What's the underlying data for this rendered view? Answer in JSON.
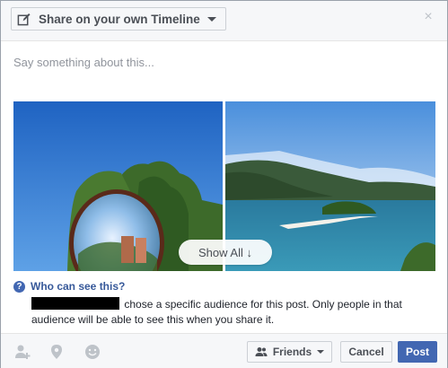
{
  "header": {
    "share_dropdown_label": "Share on your own Timeline",
    "close_symbol": "×",
    "icons": {
      "edit": "pencil-square-icon",
      "dropdown": "caret-down-icon",
      "close": "close-icon"
    }
  },
  "composer": {
    "placeholder": "Say something about this..."
  },
  "attachments": {
    "show_all_label": "Show All ↓"
  },
  "privacy": {
    "question": "Who can see this?",
    "description": "chose a specific audience for this post. Only people in that audience will be able to see this when you share it.",
    "icons": {
      "help": "question-circle-icon"
    },
    "question_mark": "?"
  },
  "footer": {
    "icons": [
      "tag-friends-icon",
      "check-in-icon",
      "feeling-icon"
    ],
    "audience_label": "Friends",
    "cancel_label": "Cancel",
    "post_label": "Post"
  },
  "colors": {
    "accent": "#4267b2",
    "link": "#365899",
    "header_bg": "#f6f7f9",
    "border": "#ccd0d5"
  }
}
